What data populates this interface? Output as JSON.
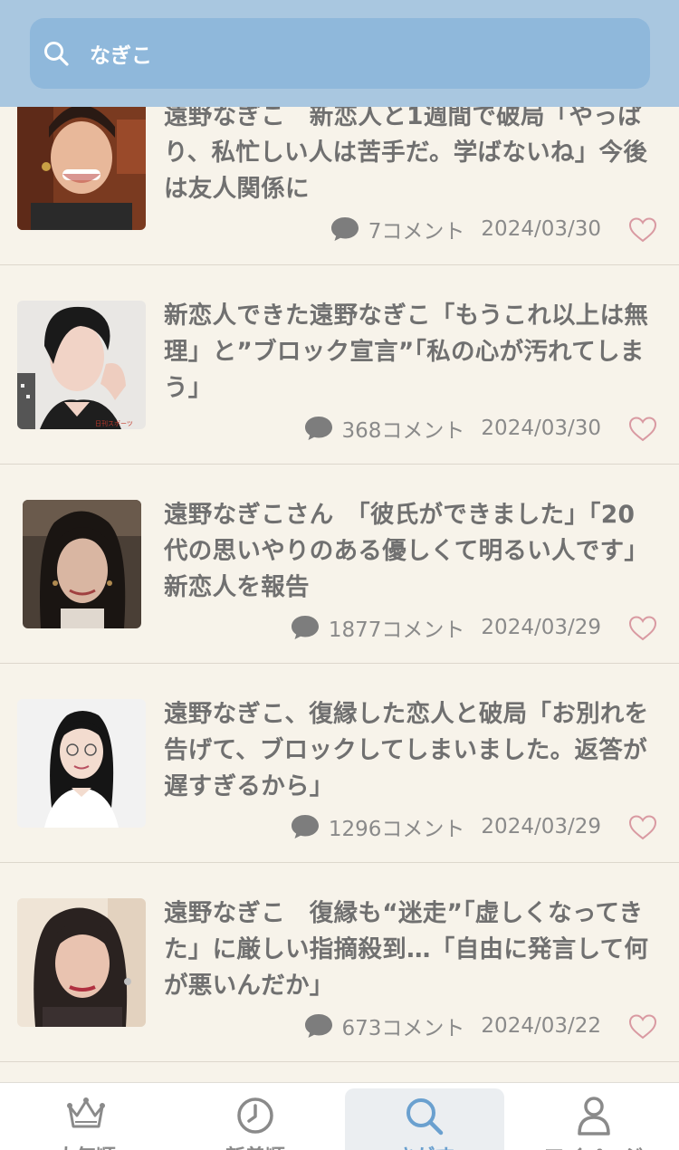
{
  "search": {
    "value": "なぎこ"
  },
  "articles": [
    {
      "title": "遠野なぎこ　新恋人と1週間で破局「やっぱり、私忙しい人は苦手だ。学ばないね」今後は友人関係に",
      "comments": "7コメント",
      "date": "2024/03/30"
    },
    {
      "title": "新恋人できた遠野なぎこ「もうこれ以上は無理」と”ブロック宣言”「私の心が汚れてしまう」",
      "comments": "368コメント",
      "date": "2024/03/30",
      "thumb_caption": "日刊スポーツ"
    },
    {
      "title": "遠野なぎこさん　「彼氏ができました」「20代の思いやりのある優しくて明るい人です」　新恋人を報告",
      "comments": "1877コメント",
      "date": "2024/03/29"
    },
    {
      "title": "遠野なぎこ、復縁した恋人と破局「お別れを告げて、ブロックしてしまいました。返答が遅すぎるから」",
      "comments": "1296コメント",
      "date": "2024/03/29"
    },
    {
      "title": "遠野なぎこ　復縁も“迷走”「虚しくなってきた」に厳しい指摘殺到…「自由に発言して何が悪いんだか」",
      "comments": "673コメント",
      "date": "2024/03/22"
    }
  ],
  "tabs": [
    {
      "label": "人気順",
      "icon": "crown-icon"
    },
    {
      "label": "新着順",
      "icon": "clock-icon"
    },
    {
      "label": "さがす",
      "icon": "search-icon",
      "active": true
    },
    {
      "label": "マイページ",
      "icon": "person-icon"
    }
  ],
  "colors": {
    "header_bg": "#a9c7e0",
    "search_bg": "#8fb8db",
    "page_bg": "#f7f3ea",
    "heart": "#d99aa2",
    "active_tab": "#6aa0cf"
  }
}
